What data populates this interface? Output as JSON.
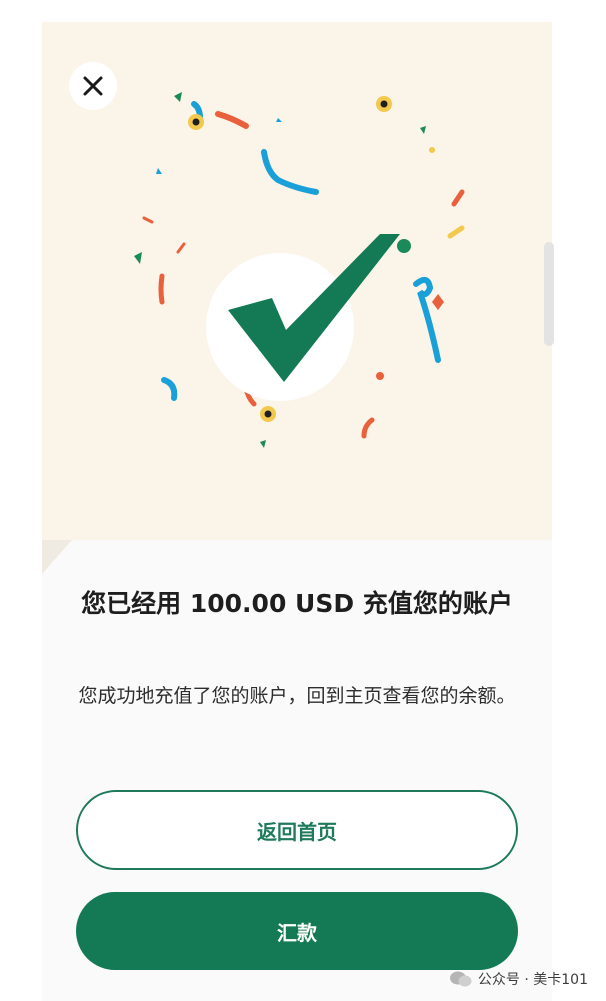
{
  "dialog": {
    "close_icon": "close-icon",
    "title": "您已经用 100.00 USD 充值您的账户",
    "message": "您成功地充值了您的账户，回到主页查看您的余额。"
  },
  "actions": {
    "back_home_label": "返回首页",
    "remit_label": "汇款"
  },
  "watermark": {
    "text": "公众号 · 美卡101"
  },
  "colors": {
    "accent": "#137a55",
    "hero_bg": "#fbf4e8",
    "check": "#137a55"
  }
}
